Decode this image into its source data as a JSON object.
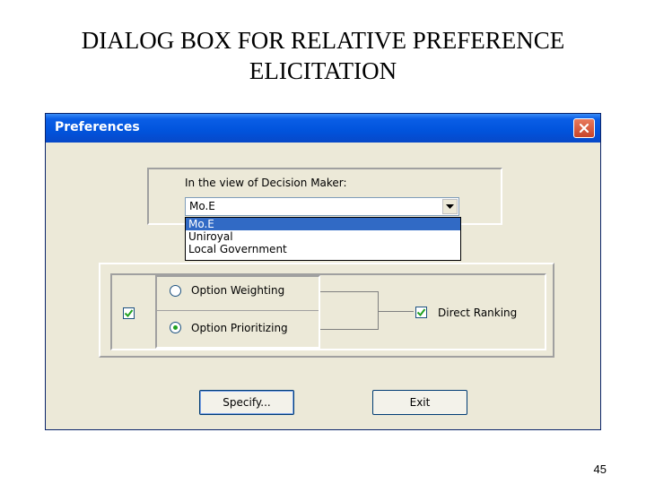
{
  "slide": {
    "title_line1": "DIALOG BOX FOR RELATIVE PREFERENCE",
    "title_line2": "ELICITATION",
    "page_number": "45"
  },
  "window": {
    "title": "Preferences",
    "close_icon": "close-icon"
  },
  "decision_maker": {
    "label": "In the view of Decision Maker:",
    "selected": "Mo.E",
    "options": [
      "Mo.E",
      "Uniroyal",
      "Local Government"
    ]
  },
  "options": {
    "weighting_label": "Option Weighting",
    "prioritizing_label": "Option Prioritizing",
    "selected_radio": "Option Prioritizing",
    "left_checkbox_checked": true,
    "direct_ranking_label": "Direct Ranking",
    "direct_ranking_checked": true
  },
  "buttons": {
    "specify": "Specify...",
    "exit": "Exit"
  },
  "colors": {
    "titlebar": "#0153dc",
    "dialog_bg": "#ece9d8",
    "selection": "#316ac5",
    "check": "#21a121"
  }
}
